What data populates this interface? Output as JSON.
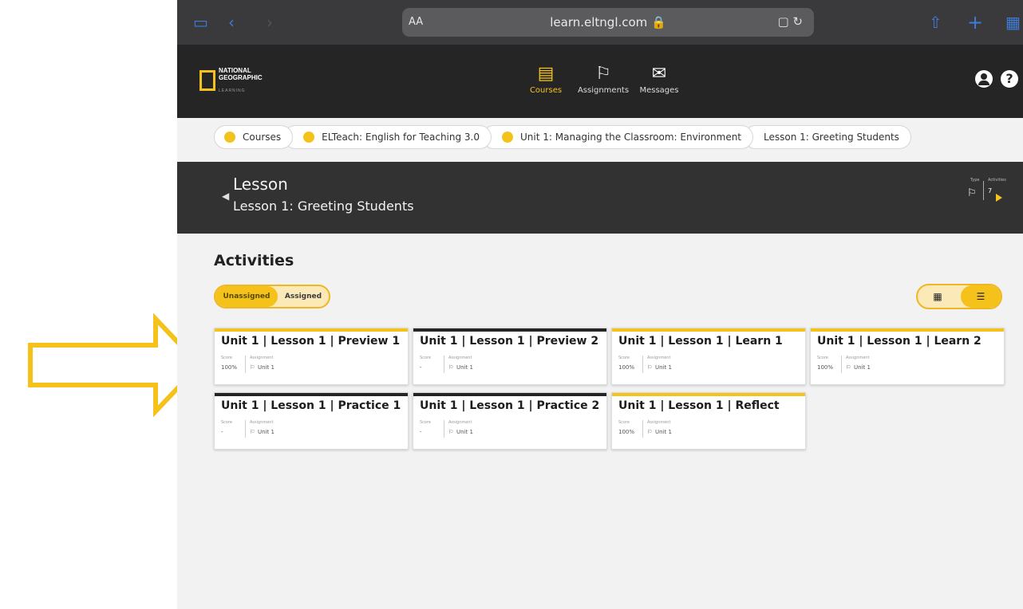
{
  "browser": {
    "text_size": "AA",
    "url": "learn.eltngl.com 🔒",
    "reader_icon": "▢ ↻"
  },
  "header": {
    "logo_line1": "NATIONAL",
    "logo_line2": "GEOGRAPHIC",
    "logo_sub": "LEARNING",
    "nav": [
      {
        "label": "Courses",
        "icon": "courses-icon",
        "active": true
      },
      {
        "label": "Assignments",
        "icon": "assignments-icon",
        "active": false
      },
      {
        "label": "Messages",
        "icon": "messages-icon",
        "active": false
      }
    ],
    "help_label": "?"
  },
  "breadcrumb": [
    {
      "label": "Courses"
    },
    {
      "label": "ELTeach: English for Teaching 3.0"
    },
    {
      "label": "Unit 1: Managing the Classroom: Environment"
    },
    {
      "label": "Lesson 1: Greeting Students"
    }
  ],
  "lesson": {
    "title": "Lesson",
    "subtitle": "Lesson 1: Greeting Students",
    "type_label": "Type",
    "activities_label": "Activities",
    "activities_count": "7"
  },
  "activities": {
    "heading": "Activities",
    "toggle_unassigned": "Unassigned",
    "toggle_assigned": "Assigned",
    "grid_view_icon": "grid-icon",
    "list_view_icon": "list-icon",
    "colors": {
      "accent": "#f5c21b",
      "dark": "#252525"
    },
    "cards": [
      {
        "title": "Unit 1 | Lesson 1 | Preview 1",
        "score_label": "Score",
        "score": "100%",
        "assignment_label": "Assignment",
        "assignment": "Unit 1",
        "bar": "yellow"
      },
      {
        "title": "Unit 1 | Lesson 1 | Preview 2",
        "score_label": "Score",
        "score": "-",
        "assignment_label": "Assignment",
        "assignment": "Unit 1",
        "bar": "black"
      },
      {
        "title": "Unit 1 | Lesson 1 | Learn 1",
        "score_label": "Score",
        "score": "100%",
        "assignment_label": "Assignment",
        "assignment": "Unit 1",
        "bar": "yellow"
      },
      {
        "title": "Unit 1 | Lesson 1 | Learn 2",
        "score_label": "Score",
        "score": "100%",
        "assignment_label": "Assignment",
        "assignment": "Unit 1",
        "bar": "yellow"
      },
      {
        "title": "Unit 1 | Lesson 1 | Practice 1",
        "score_label": "Score",
        "score": "-",
        "assignment_label": "Assignment",
        "assignment": "Unit 1",
        "bar": "black"
      },
      {
        "title": "Unit 1 | Lesson 1 | Practice 2",
        "score_label": "Score",
        "score": "-",
        "assignment_label": "Assignment",
        "assignment": "Unit 1",
        "bar": "black"
      },
      {
        "title": "Unit 1 | Lesson 1 | Reflect",
        "score_label": "Score",
        "score": "100%",
        "assignment_label": "Assignment",
        "assignment": "Unit 1",
        "bar": "yellow"
      }
    ]
  },
  "annotation": {
    "arrow_color": "#f5c21b"
  }
}
